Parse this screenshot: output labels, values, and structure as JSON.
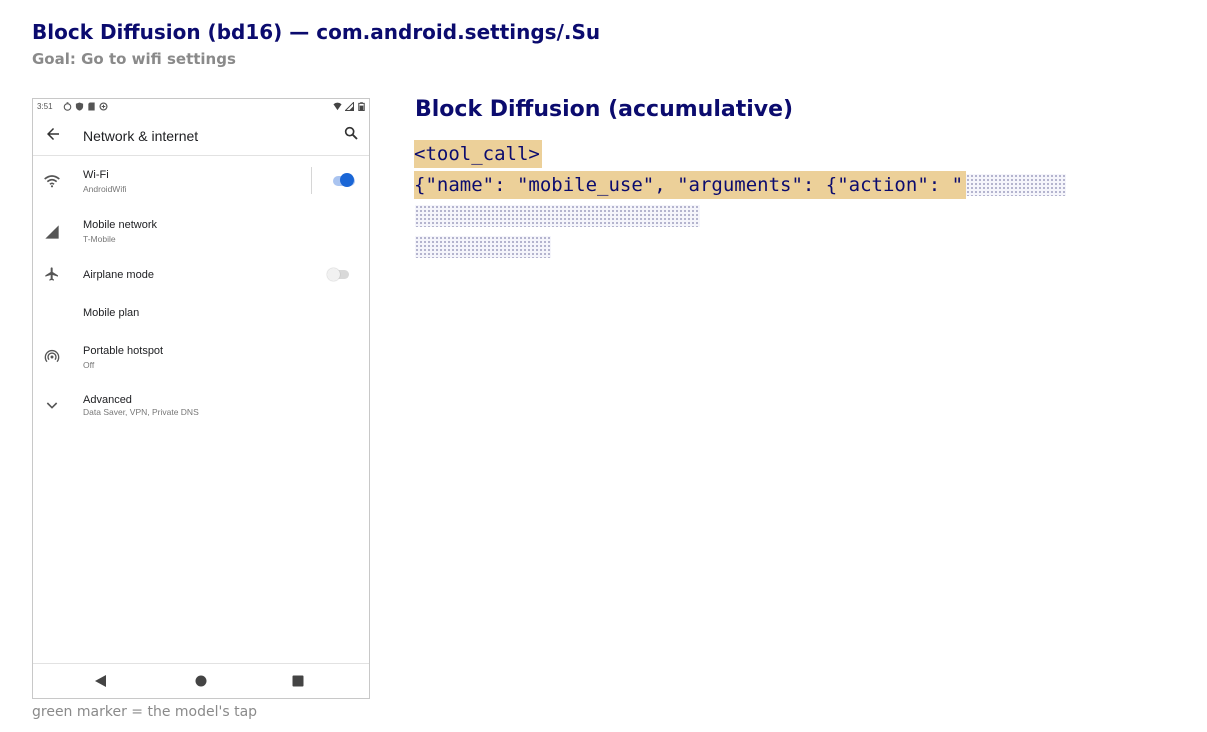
{
  "header": {
    "title": "Block Diffusion (bd16) — com.android.settings/.Su",
    "goal": "Goal: Go to wifi settings"
  },
  "phone": {
    "status_bar": {
      "time": "3:51",
      "left_icons": [
        "timer-icon",
        "shield-icon",
        "sd-card-icon",
        "data-saver-icon"
      ],
      "right_icons": [
        "wifi-signal-icon",
        "cell-signal-icon",
        "battery-icon"
      ]
    },
    "toolbar": {
      "title": "Network & internet",
      "back_icon": "arrow-back-icon",
      "search_icon": "search-icon"
    },
    "items": [
      {
        "title": "Wi-Fi",
        "subtitle": "AndroidWifi",
        "icon": "wifi-icon",
        "toggle": "on"
      },
      {
        "title": "Mobile network",
        "subtitle": "T-Mobile",
        "icon": "cell-signal-icon"
      },
      {
        "title": "Airplane mode",
        "subtitle": "",
        "icon": "airplane-icon",
        "toggle": "off"
      },
      {
        "title": "Mobile plan",
        "subtitle": "",
        "icon": ""
      },
      {
        "title": "Portable hotspot",
        "subtitle": "Off",
        "icon": "hotspot-icon"
      },
      {
        "title": "Advanced",
        "subtitle": "Data Saver, VPN, Private DNS",
        "icon": "chevron-down-icon"
      }
    ],
    "nav_bar": [
      "back-triangle-icon",
      "home-circle-icon",
      "recents-square-icon"
    ]
  },
  "caption": "green marker = the model's tap",
  "panel": {
    "title": "Block Diffusion (accumulative)",
    "decoded_line_1": "<tool_call>",
    "decoded_line_2": "{\"name\": \"mobile_use\", \"arguments\": {\"action\": \"",
    "decoded_color": "#ecd099",
    "masked_color": "#a3a3c2"
  }
}
